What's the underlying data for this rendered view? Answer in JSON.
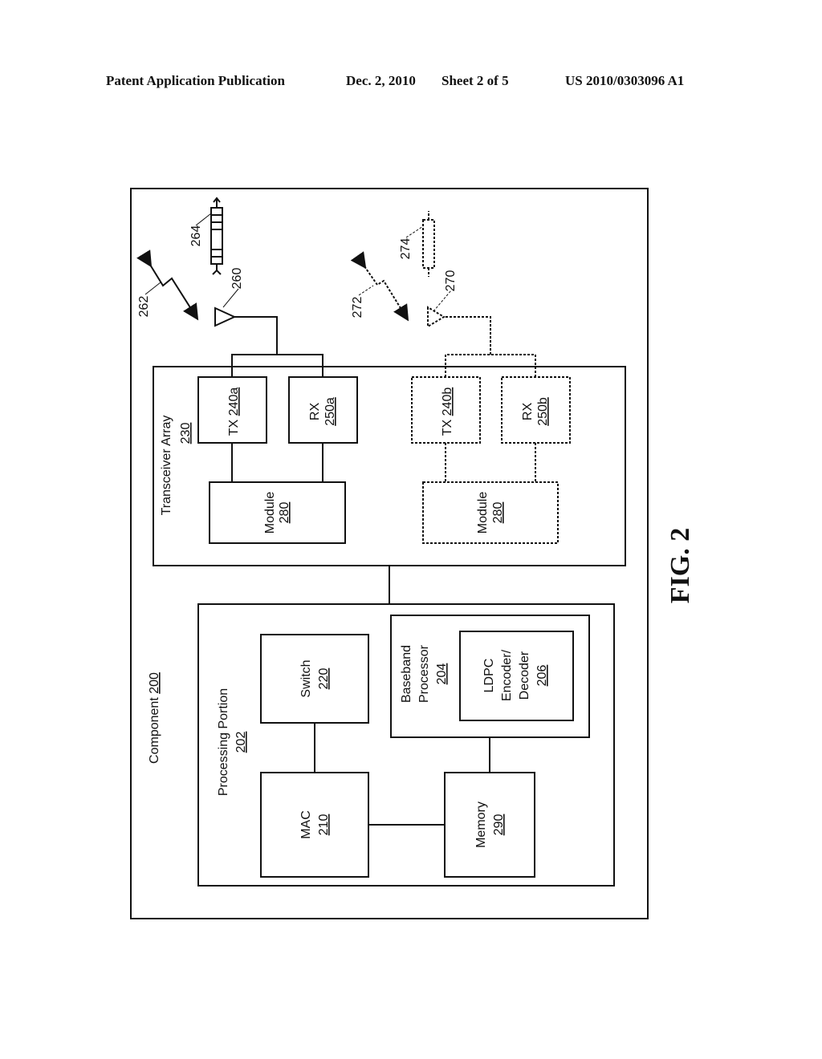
{
  "header": {
    "publication": "Patent Application Publication",
    "date": "Dec. 2, 2010",
    "sheet": "Sheet 2 of 5",
    "number": "US 2010/0303096 A1"
  },
  "figure": {
    "label": "FIG. 2",
    "component": {
      "name": "Component",
      "ref": "200"
    },
    "transceiver_array": {
      "name": "Transceiver Array",
      "ref": "230"
    },
    "tx_a": {
      "name": "TX",
      "ref": "240a"
    },
    "rx_a": {
      "name": "RX",
      "ref": "250a"
    },
    "module_a": {
      "name": "Module",
      "ref": "280"
    },
    "tx_b": {
      "name": "TX",
      "ref": "240b"
    },
    "rx_b": {
      "name": "RX",
      "ref": "250b"
    },
    "module_b": {
      "name": "Module",
      "ref": "280"
    },
    "processing_portion": {
      "name": "Processing Portion",
      "ref": "202"
    },
    "switch": {
      "name": "Switch",
      "ref": "220"
    },
    "mac": {
      "name": "MAC",
      "ref": "210"
    },
    "baseband": {
      "line1": "Baseband",
      "line2": "Processor",
      "ref": "204"
    },
    "ldpc": {
      "line1": "LDPC",
      "line2": "Encoder/",
      "line3": "Decoder",
      "ref": "206"
    },
    "memory": {
      "name": "Memory",
      "ref": "290"
    },
    "antenna_a_ref": "260",
    "signal_a_ref": "262",
    "packet_a_ref": "264",
    "antenna_b_ref": "270",
    "signal_b_ref": "272",
    "packet_b_ref": "274"
  }
}
